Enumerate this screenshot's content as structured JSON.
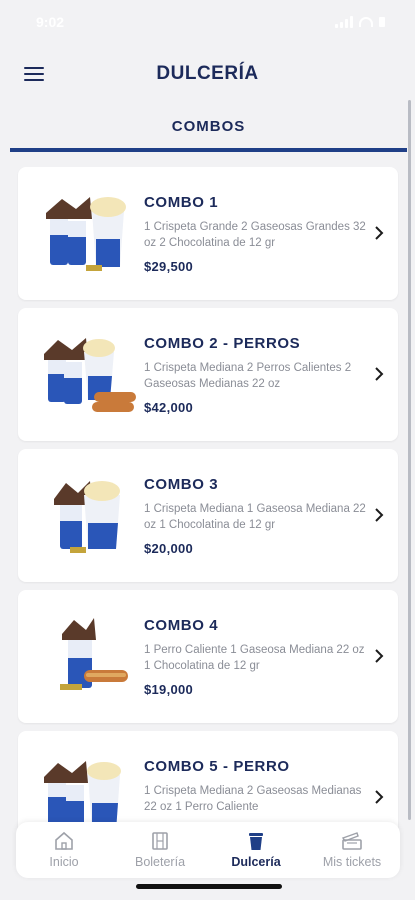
{
  "status_bar": {
    "time": "9:02"
  },
  "header": {
    "title": "DULCERÍA"
  },
  "tabs": {
    "active": "COMBOS"
  },
  "combos": [
    {
      "name": "COMBO 1",
      "description": "1 Crispeta Grande 2 Gaseosas Grandes 32 oz 2 Chocolatina de 12 gr",
      "price": "$29,500"
    },
    {
      "name": "COMBO 2 - PERROS",
      "description": "1 Crispeta Mediana 2 Perros Calientes 2 Gaseosas Medianas 22 oz",
      "price": "$42,000"
    },
    {
      "name": "COMBO 3",
      "description": "1 Crispeta Mediana 1 Gaseosa Mediana 22 oz 1 Chocolatina de 12 gr",
      "price": "$20,000"
    },
    {
      "name": "COMBO 4",
      "description": "1 Perro Caliente 1 Gaseosa Mediana 22 oz 1 Chocolatina de 12 gr",
      "price": "$19,000"
    },
    {
      "name": "COMBO 5 - PERRO",
      "description": "1 Crispeta Mediana 2 Gaseosas Medianas 22 oz 1 Perro Caliente",
      "price": ""
    }
  ],
  "bottom_nav": {
    "items": [
      {
        "label": "Inicio",
        "icon": "home-icon"
      },
      {
        "label": "Boletería",
        "icon": "film-icon"
      },
      {
        "label": "Dulcería",
        "icon": "cup-icon"
      },
      {
        "label": "Mis tickets",
        "icon": "ticket-icon"
      }
    ],
    "active": "Dulcería"
  },
  "colors": {
    "primary": "#1c2a5a",
    "accent": "#1f3f87",
    "muted": "#9ea1a9",
    "background": "#f2f2f4"
  }
}
